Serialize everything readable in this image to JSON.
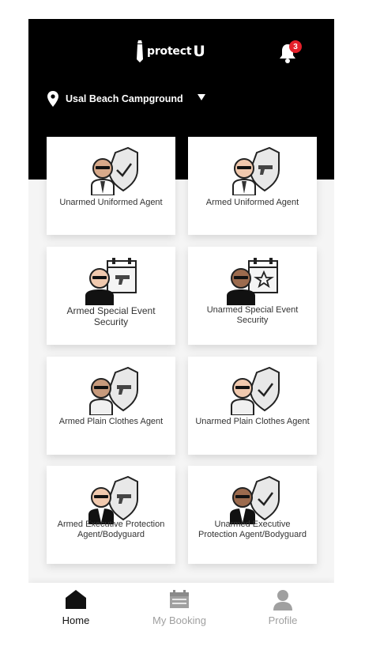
{
  "app": {
    "logo_text": "protect",
    "logo_letter": "U",
    "notification_count": "3"
  },
  "location": {
    "name": "Usal Beach Campground"
  },
  "services": [
    {
      "label": "Unarmed Uniformed Agent",
      "icon": "uniformed-agent-shield-check-icon"
    },
    {
      "label": "Armed Uniformed Agent",
      "icon": "uniformed-agent-shield-gun-icon"
    },
    {
      "label": "Armed Special Event Security",
      "icon": "event-security-calendar-gun-icon"
    },
    {
      "label": "Unarmed Special Event Security",
      "icon": "event-security-calendar-star-icon"
    },
    {
      "label": "Armed Plain Clothes Agent",
      "icon": "plain-clothes-shield-gun-icon"
    },
    {
      "label": "Unarmed Plain Clothes Agent",
      "icon": "plain-clothes-shield-check-icon"
    },
    {
      "label": "Armed Executive Protection Agent/Bodyguard",
      "icon": "executive-bodyguard-shield-gun-icon"
    },
    {
      "label": "Unarmed Executive Protection Agent/Bodyguard",
      "icon": "executive-bodyguard-shield-check-icon"
    }
  ],
  "nav": {
    "home": "Home",
    "booking": "My Booking",
    "profile": "Profile"
  },
  "colors": {
    "header": "#000000",
    "badge": "#e4202a",
    "nav_active": "#111111",
    "nav_inactive": "#a0a0a0"
  }
}
